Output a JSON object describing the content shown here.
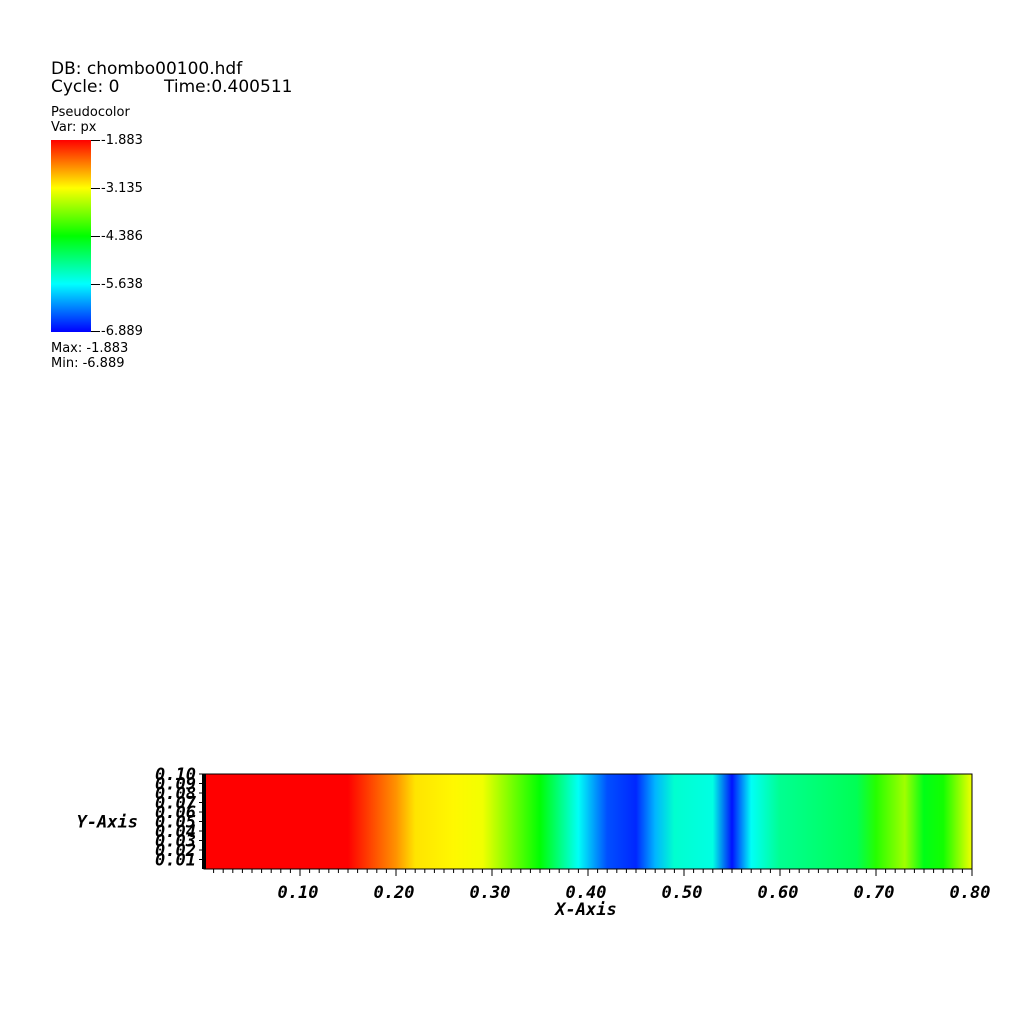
{
  "header": {
    "db": "DB: chombo00100.hdf",
    "cycle": "Cycle: 0",
    "time": "Time:0.400511"
  },
  "legend": {
    "plot_type": "Pseudocolor",
    "variable": "Var: px",
    "ticks": [
      "-1.883",
      "-3.135",
      "-4.386",
      "-5.638",
      "-6.889"
    ],
    "max_label": "Max: -1.883",
    "min_label": "Min: -6.889",
    "colormap": [
      "#ff0000",
      "#ffff00",
      "#00ff00",
      "#00ffff",
      "#0000ff"
    ]
  },
  "chart_data": {
    "type": "heatmap",
    "title": "",
    "xlabel": "X-Axis",
    "ylabel": "Y-Axis",
    "xlim": [
      0,
      0.8
    ],
    "ylim": [
      0,
      0.1
    ],
    "x_ticks": [
      "0.10",
      "0.20",
      "0.30",
      "0.40",
      "0.50",
      "0.60",
      "0.70",
      "0.80"
    ],
    "y_ticks": [
      "0.01",
      "0.02",
      "0.03",
      "0.04",
      "0.05",
      "0.06",
      "0.07",
      "0.08",
      "0.09",
      "0.10"
    ],
    "value_range": [
      -6.889,
      -1.883
    ],
    "profile_x": [
      0.0,
      0.15,
      0.2,
      0.22,
      0.26,
      0.29,
      0.31,
      0.35,
      0.39,
      0.42,
      0.45,
      0.47,
      0.49,
      0.53,
      0.55,
      0.57,
      0.6,
      0.68,
      0.7,
      0.73,
      0.75,
      0.77,
      0.8
    ],
    "profile_value": [
      -1.883,
      -1.883,
      -2.6,
      -3.0,
      -3.1,
      -3.2,
      -3.6,
      -4.4,
      -5.6,
      -6.5,
      -6.7,
      -6.0,
      -5.4,
      -5.5,
      -6.8,
      -5.6,
      -5.1,
      -4.8,
      -4.2,
      -3.6,
      -4.5,
      -4.3,
      -3.2
    ]
  }
}
